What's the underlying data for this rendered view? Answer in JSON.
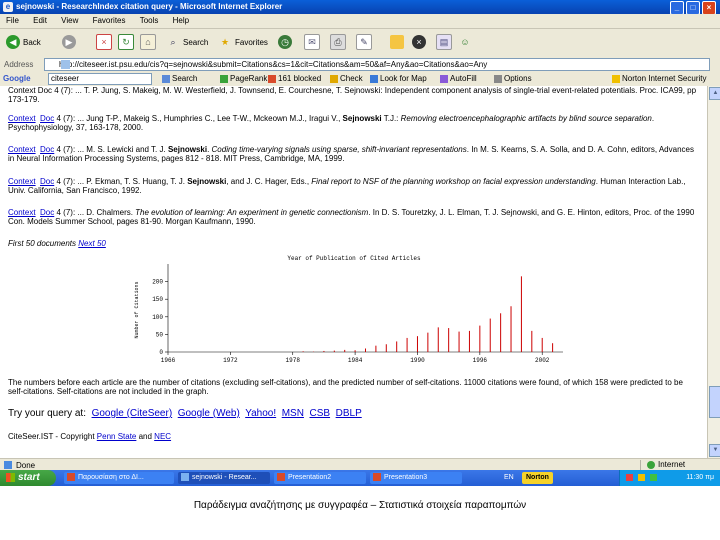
{
  "window": {
    "title": "sejnowski - ResearchIndex citation query - Microsoft Internet Explorer"
  },
  "menu": [
    "File",
    "Edit",
    "View",
    "Favorites",
    "Tools",
    "Help"
  ],
  "toolbar": {
    "back": "Back",
    "search": "Search",
    "favorites": "Favorites"
  },
  "address": {
    "label": "Address",
    "url": "http://citeseer.ist.psu.edu/cis?q=sejnowski&submit=Citations&cs=1&cit=Citations&am=50&af=Any&ao=Citations&ao=Any"
  },
  "googlebar": {
    "logo": "Google",
    "query": "citeseer",
    "buttons": [
      "Search",
      "PageRank",
      "161 blocked",
      "Check",
      "Look for Map",
      "AutoFill",
      "Options"
    ],
    "norton": "Norton Internet Security"
  },
  "results": [
    {
      "text": "Context  Doc  4 (7): ... T. P. Jung, S. Makeig, M. W. Westerfield, J. Townsend, E. Courchesne, T. Sejnowski: Independent component analysis of single-trial event-related potentials. Proc. ICA99, pp 173-179."
    },
    {
      "context": "Context",
      "doc": "Doc",
      "prefix": " 4 (7): ... Jung T-P., Makeig S., Humphries C., Lee T-W., Mckeown M.J., Iragui V., ",
      "author": "Sejnowski",
      "authorTail": " T.J.: ",
      "title": "Removing electroencephalographic artifacts by blind source separation",
      "suffix": ". Psychophysiology, 37, 163-178, 2000."
    },
    {
      "context": "Context",
      "doc": "Doc",
      "prefix": " 4 (7): ... M. S. Lewicki and T. J. ",
      "author": "Sejnowski",
      "authorTail": ". ",
      "title": "Coding time-varying signals using sparse, shift-invariant representations",
      "suffix": ". In M. S. Kearns, S. A. Solla, and D. A. Cohn, editors, Advances in Neural Information Processing Systems, pages 812 - 818. MIT Press, Cambridge, MA, 1999."
    },
    {
      "context": "Context",
      "doc": "Doc",
      "prefix": " 4 (7): ... P. Ekman, T. S. Huang, T. J. ",
      "author": "Sejnowski",
      "authorTail": ", and J. C. Hager, Eds., ",
      "title": "Final report to NSF of the planning workshop on facial expression understanding",
      "suffix": ". Human Interaction Lab., Univ. California, San Francisco, 1992."
    },
    {
      "context": "Context",
      "doc": "Doc",
      "prefix": " 4 (7): ... D. Chalmers. ",
      "title": "The evolution of learning: An experiment in genetic connectionism",
      "suffix": ". In D. S. Touretzky, J. L. Elman, T. J. Sejnowski, and G. E. Hinton, editors, Proc. of the 1990 Con. Models Summer School, pages 81-90. Morgan Kaufmann, 1990."
    }
  ],
  "firstLink": "First 50 documents",
  "nextLink": "Next 50",
  "footnote": "The numbers before each article are the number of citations (excluding self-citations), and the predicted number of self-citations. 11000 citations were found, of which 158 were predicted to be self-citations. Self-citations are not included in the graph.",
  "tryQuery": {
    "label": "Try your query at:",
    "links": [
      "Google (CiteSeer)",
      "Google (Web)",
      "Yahoo!",
      "MSN",
      "CSB",
      "DBLP"
    ]
  },
  "copyright": {
    "prefix": "CiteSeer.IST - Copyright ",
    "org1": "Penn State",
    "and": " and ",
    "org2": "NEC"
  },
  "status": {
    "text": "Done",
    "zone": "Internet"
  },
  "taskbar": {
    "start": "start",
    "tasks": [
      "Παρουσίαση στο ΔΙ...",
      "sejnowski - Resear...",
      "Presentation2",
      "Presentation3"
    ],
    "lang": "EN",
    "tray": "Norton",
    "clock": "11:30 πμ"
  },
  "caption": "Παράδειγμα αναζήτησης με συγγραφέα – Στατιστικά στοιχεία παραπομπών",
  "chart_data": {
    "type": "bar",
    "title": "Year of Publication of Cited Articles",
    "ylabel": "Number of Citations",
    "xlabel": "",
    "xlim": [
      1966,
      2004
    ],
    "ylim": [
      0,
      250
    ],
    "xticks": [
      1966,
      1972,
      1978,
      1984,
      1990,
      1996,
      2002
    ],
    "yticks": [
      0,
      50,
      100,
      150,
      200
    ],
    "color": "#cc0000",
    "x": [
      1979,
      1980,
      1981,
      1982,
      1983,
      1984,
      1985,
      1986,
      1987,
      1988,
      1989,
      1990,
      1991,
      1992,
      1993,
      1994,
      1995,
      1996,
      1997,
      1998,
      1999,
      2000,
      2001,
      2002,
      2003
    ],
    "values": [
      2,
      1,
      3,
      4,
      6,
      5,
      10,
      18,
      22,
      30,
      40,
      45,
      55,
      70,
      68,
      58,
      60,
      75,
      95,
      110,
      130,
      215,
      60,
      40,
      25
    ]
  }
}
